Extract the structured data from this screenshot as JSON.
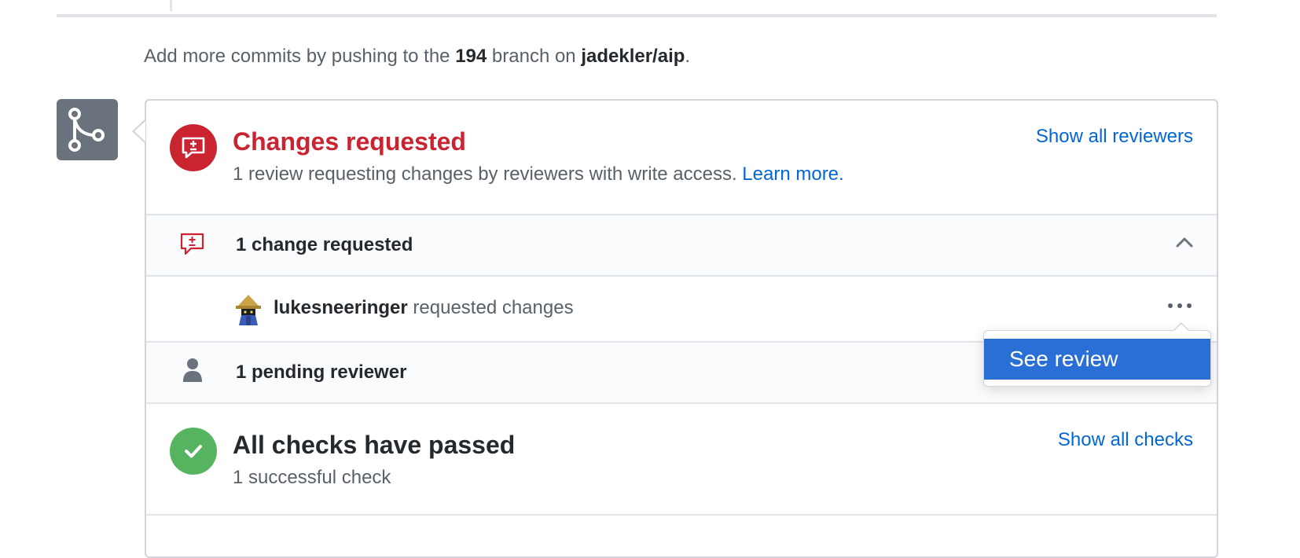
{
  "hint": {
    "prefix": "Add more commits by pushing to the ",
    "branch": "194",
    "middle": " branch on ",
    "repo": "jadekler/aip",
    "suffix": "."
  },
  "changes": {
    "title": "Changes requested",
    "description": "1 review requesting changes by reviewers with write access.",
    "learn_more": "Learn more.",
    "show_all_reviewers": "Show all reviewers"
  },
  "change_count": {
    "label": "1 change requested"
  },
  "reviewer": {
    "username": "lukesneeringer",
    "action": " requested changes"
  },
  "pending": {
    "label": "1 pending reviewer"
  },
  "checks": {
    "title": "All checks have passed",
    "subtitle": "1 successful check",
    "show_all_checks": "Show all checks"
  },
  "dropdown": {
    "see_review": "See review"
  },
  "colors": {
    "danger": "#cb2431",
    "success": "#56b35f",
    "link": "#0366d6",
    "menu_highlight": "#2a6fd6",
    "merge_badge": "#6a737d"
  },
  "icons": {
    "merge_badge": "git-branch-icon",
    "changes": "file-diff-comment-icon",
    "check": "check-icon",
    "person": "person-icon",
    "chevron": "chevron-up-icon",
    "more": "kebab-horizontal-icon"
  }
}
